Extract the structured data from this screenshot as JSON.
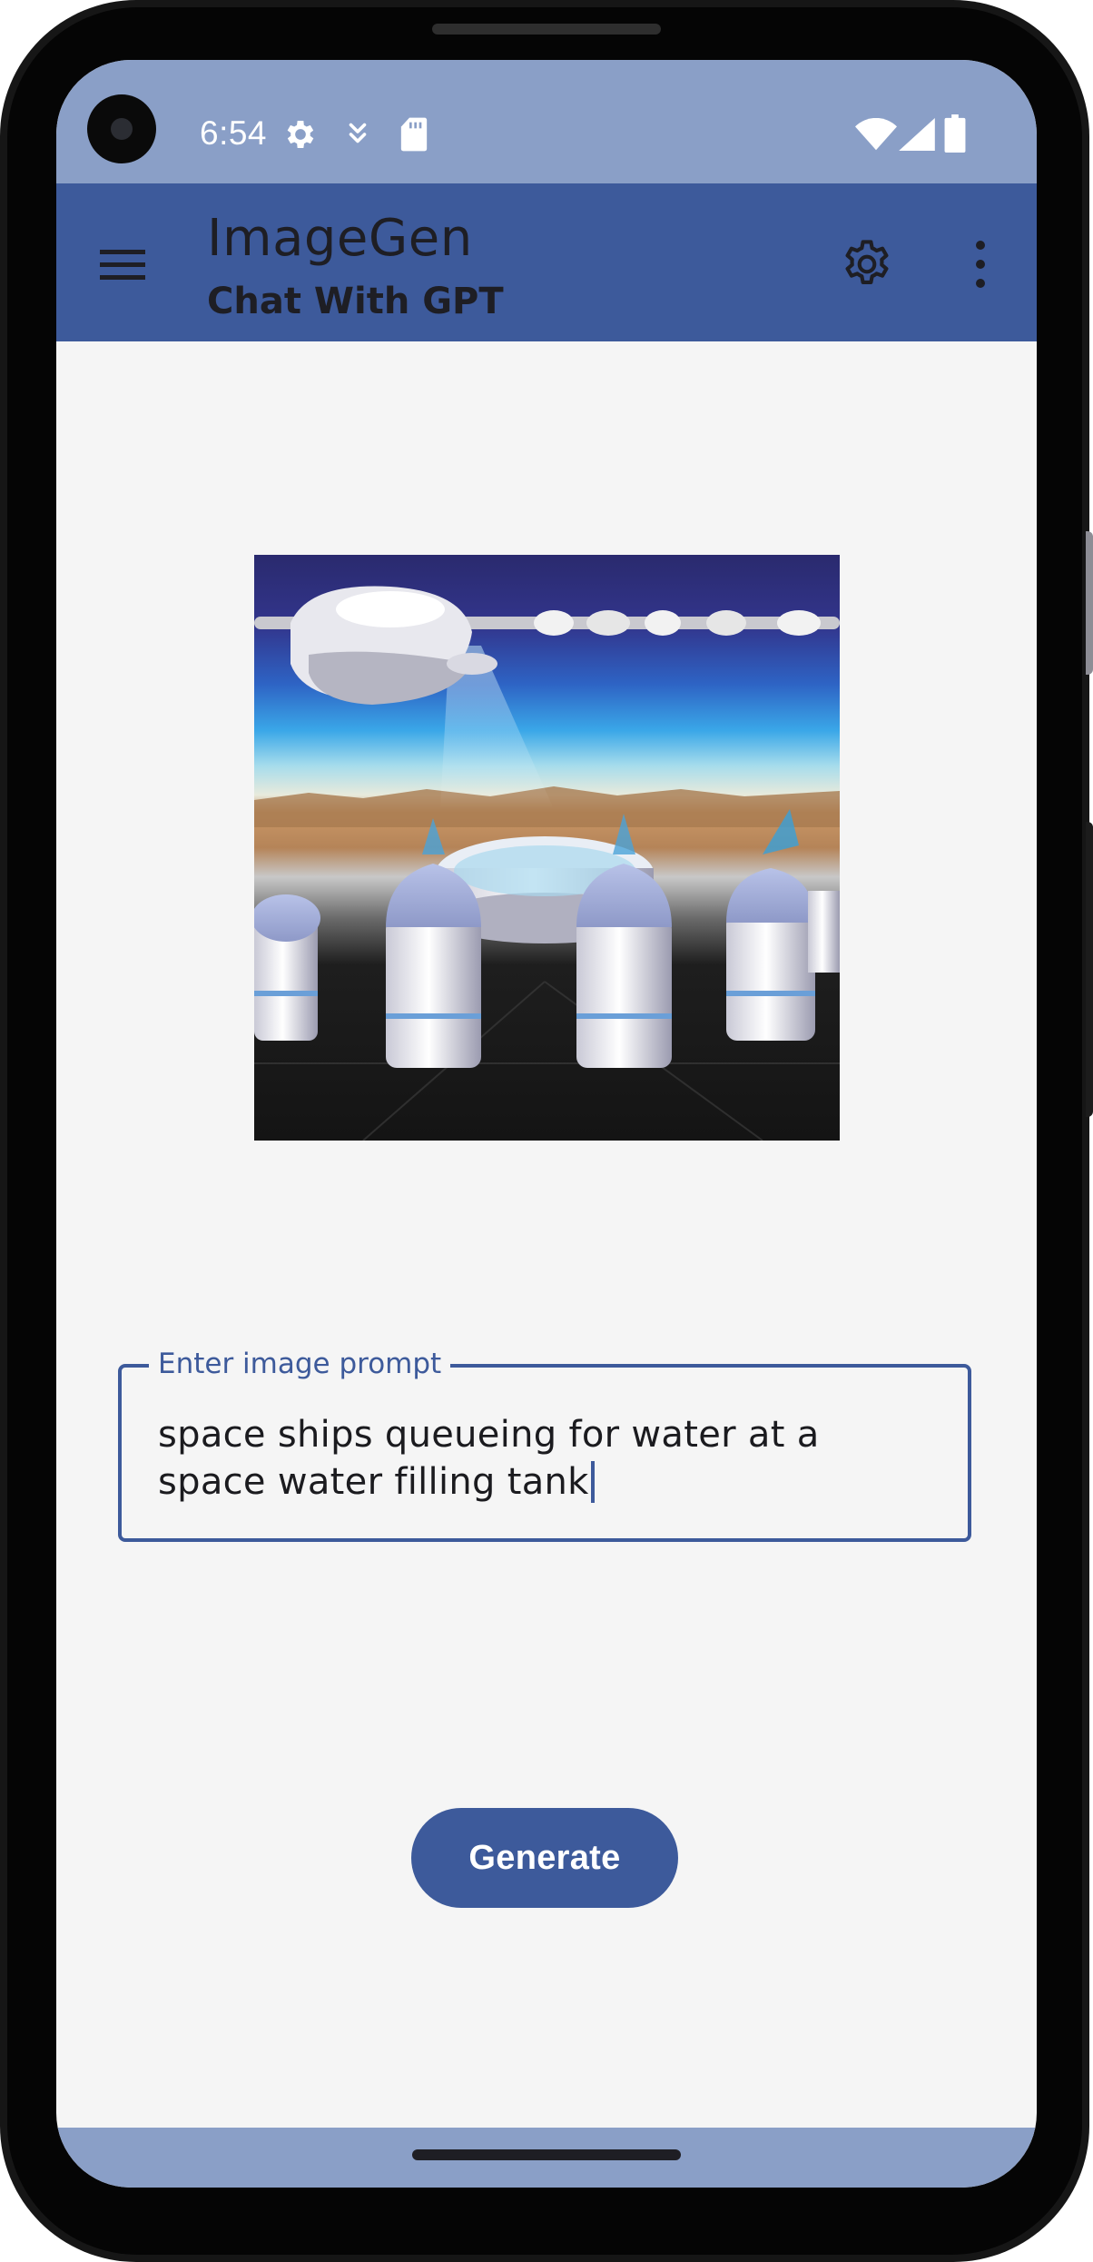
{
  "status_bar": {
    "time": "6:54",
    "icons": [
      "settings-gear-icon",
      "download-icon",
      "sd-card-icon",
      "wifi-icon",
      "cellular-signal-icon",
      "battery-icon"
    ]
  },
  "app_bar": {
    "title": "ImageGen",
    "subtitle": "Chat With GPT",
    "icons": [
      "menu-icon",
      "settings-icon",
      "more-vert-icon"
    ]
  },
  "prompt": {
    "label": "Enter image prompt",
    "value": "space ships queueing for water at a space water filling tank"
  },
  "generate_button": {
    "label": "Generate"
  },
  "colors": {
    "primary": "#3d5a9b",
    "status_bar": "#8a9fc7",
    "background": "#f5f5f5",
    "on_surface": "#1e1e24"
  }
}
